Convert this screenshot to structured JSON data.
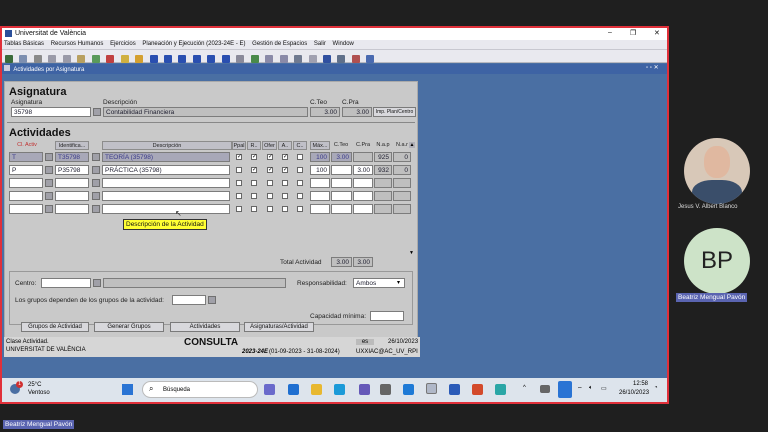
{
  "window": {
    "title": "Universitat de València",
    "controls": [
      "–",
      "❐",
      "✕"
    ]
  },
  "menu": [
    "Tablas Básicas",
    "Recursos Humanos",
    "Ejercicios",
    "Planeación y Ejecución (2023-24E - E)",
    "Gestión de Espacios",
    "Salir",
    "Window"
  ],
  "subwindow": {
    "title": "Actividades por Asignatura"
  },
  "asignatura": {
    "section_title": "Asignatura",
    "label_asignatura": "Asignatura",
    "label_descripcion": "Descripción",
    "label_cteo": "C.Teo",
    "label_cpra": "C.Pra",
    "codigo": "35798",
    "descripcion": "Contabilidad Financiera",
    "cteo": "3.00",
    "cpra": "3.00",
    "btn_imp": "Imp. Plan/Centro"
  },
  "actividades": {
    "section_title": "Actividades",
    "headers": {
      "cl_activ": "Cl. Activ",
      "identific": "Identifica...",
      "descripcion": "Descripción",
      "ppal": "Ppal",
      "r": "R..",
      "ofer": "Ofer",
      "a": "A..",
      "c": "C..",
      "max": "Máx...",
      "cteo": "C.Teo",
      "cpra": "C.Pra",
      "nap": "N.a.p",
      "nar": "N.a.r"
    },
    "rows": [
      {
        "cl": "T",
        "id": "T35798",
        "desc": "TEORÍA (35798)",
        "ppal": "✓",
        "r": "✓",
        "ofer": "✓",
        "a": "✓",
        "c": "",
        "max": "100",
        "cteo": "3.00",
        "cpra": "",
        "nap": "925",
        "nar": "0"
      },
      {
        "cl": "P",
        "id": "P35798",
        "desc": "PRÁCTICA (35798)",
        "ppal": "",
        "r": "✓",
        "ofer": "✓",
        "a": "✓",
        "c": "",
        "max": "100",
        "cteo": "",
        "cpra": "3.00",
        "nap": "932",
        "nar": "0"
      }
    ],
    "tooltip": "Descripción de la Actividad",
    "total_label": "Total Actividad",
    "total_cteo": "3.00",
    "total_cpra": "3.00",
    "centro_label": "Centro:",
    "responsabilidad_label": "Responsabilidad:",
    "responsabilidad_value": "Ambos",
    "grupos_label": "Los grupos dependen de los grupos de la actividad:",
    "capacidad_label": "Capacidad mínima:"
  },
  "buttons": [
    "Grupos de Actividad",
    "Generar Grupos",
    "Actividades",
    "Asignaturas/Actividad"
  ],
  "status": {
    "line1": "Clase Actividad.",
    "line2": "UNIVERSITAT DE VALÈNCIA",
    "mode": "CONSULTA",
    "year": "2023-24E",
    "period": "(01-09-2023 - 31-08-2024)",
    "es": "es",
    "date": "26/10/2023",
    "user": "UXXIAC@AC_UV_RPI"
  },
  "taskbar": {
    "temp": "25°C",
    "weather": "Ventoso",
    "search": "Búsqueda",
    "time": "12:58",
    "date": "26/10/2023",
    "weather_badge": "1"
  },
  "participants": [
    {
      "name": "Jesus V. Albert Blanco",
      "initials": ""
    },
    {
      "name": "Beatriz Mengual Pavón",
      "initials": "BP",
      "color": "#cde3c8"
    }
  ],
  "active_speaker": "Beatriz Mengual Pavón",
  "colors": {
    "accent_border": "#e0303a",
    "window_bg": "#4a6fa3",
    "form_bg": "#c9c9c9"
  }
}
